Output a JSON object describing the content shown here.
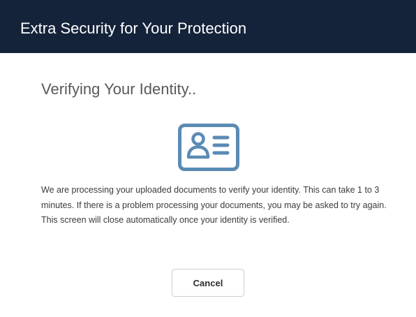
{
  "header": {
    "title": "Extra Security for Your Protection"
  },
  "main": {
    "title": "Verifying Your Identity..",
    "icon": "id-card-icon",
    "message": "We are processing your uploaded documents to verify your identity. This can take 1 to 3 minutes. If there is a problem processing your documents, you may be asked to try again. This screen will close automatically once your identity is verified."
  },
  "actions": {
    "cancel_label": "Cancel"
  },
  "colors": {
    "header_bg": "#14233a",
    "icon": "#5b8bb5"
  }
}
